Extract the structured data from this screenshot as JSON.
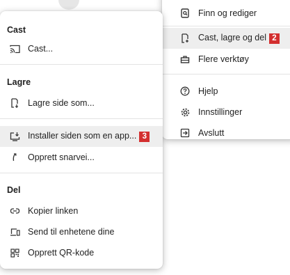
{
  "main_menu": {
    "items": [
      {
        "label": "Finn og rediger",
        "icon": "find-edit-icon"
      },
      {
        "label": "Cast, lagre og del",
        "icon": "cast-save-share-icon",
        "badge": "2"
      },
      {
        "label": "Flere verktøy",
        "icon": "toolbox-icon"
      },
      {
        "label": "Hjelp",
        "icon": "help-icon"
      },
      {
        "label": "Innstillinger",
        "icon": "gear-icon"
      },
      {
        "label": "Avslutt",
        "icon": "exit-icon"
      }
    ]
  },
  "sub_menu": {
    "sections": [
      {
        "heading": "Cast",
        "items": [
          {
            "label": "Cast...",
            "icon": "cast-icon"
          }
        ]
      },
      {
        "heading": "Lagre",
        "items": [
          {
            "label": "Lagre side som...",
            "icon": "save-page-icon"
          }
        ]
      },
      {
        "heading": "",
        "items": [
          {
            "label": "Installer siden som en app...",
            "icon": "install-app-icon",
            "badge": "3"
          },
          {
            "label": "Opprett snarvei...",
            "icon": "shortcut-icon"
          }
        ]
      },
      {
        "heading": "Del",
        "items": [
          {
            "label": "Kopier linken",
            "icon": "link-icon"
          },
          {
            "label": "Send til enhetene dine",
            "icon": "devices-icon"
          },
          {
            "label": "Opprett QR-kode",
            "icon": "qr-code-icon"
          }
        ]
      }
    ]
  }
}
